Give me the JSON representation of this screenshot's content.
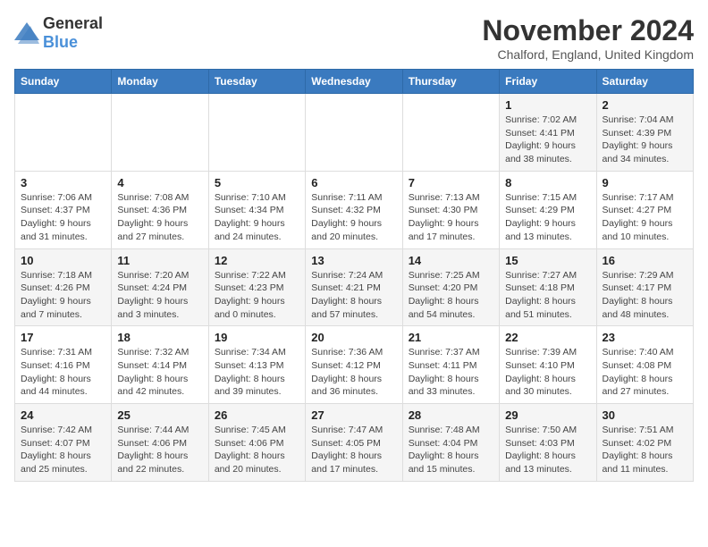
{
  "logo": {
    "general": "General",
    "blue": "Blue"
  },
  "title": "November 2024",
  "location": "Chalford, England, United Kingdom",
  "weekdays": [
    "Sunday",
    "Monday",
    "Tuesday",
    "Wednesday",
    "Thursday",
    "Friday",
    "Saturday"
  ],
  "weeks": [
    [
      {
        "day": "",
        "info": ""
      },
      {
        "day": "",
        "info": ""
      },
      {
        "day": "",
        "info": ""
      },
      {
        "day": "",
        "info": ""
      },
      {
        "day": "",
        "info": ""
      },
      {
        "day": "1",
        "info": "Sunrise: 7:02 AM\nSunset: 4:41 PM\nDaylight: 9 hours and 38 minutes."
      },
      {
        "day": "2",
        "info": "Sunrise: 7:04 AM\nSunset: 4:39 PM\nDaylight: 9 hours and 34 minutes."
      }
    ],
    [
      {
        "day": "3",
        "info": "Sunrise: 7:06 AM\nSunset: 4:37 PM\nDaylight: 9 hours and 31 minutes."
      },
      {
        "day": "4",
        "info": "Sunrise: 7:08 AM\nSunset: 4:36 PM\nDaylight: 9 hours and 27 minutes."
      },
      {
        "day": "5",
        "info": "Sunrise: 7:10 AM\nSunset: 4:34 PM\nDaylight: 9 hours and 24 minutes."
      },
      {
        "day": "6",
        "info": "Sunrise: 7:11 AM\nSunset: 4:32 PM\nDaylight: 9 hours and 20 minutes."
      },
      {
        "day": "7",
        "info": "Sunrise: 7:13 AM\nSunset: 4:30 PM\nDaylight: 9 hours and 17 minutes."
      },
      {
        "day": "8",
        "info": "Sunrise: 7:15 AM\nSunset: 4:29 PM\nDaylight: 9 hours and 13 minutes."
      },
      {
        "day": "9",
        "info": "Sunrise: 7:17 AM\nSunset: 4:27 PM\nDaylight: 9 hours and 10 minutes."
      }
    ],
    [
      {
        "day": "10",
        "info": "Sunrise: 7:18 AM\nSunset: 4:26 PM\nDaylight: 9 hours and 7 minutes."
      },
      {
        "day": "11",
        "info": "Sunrise: 7:20 AM\nSunset: 4:24 PM\nDaylight: 9 hours and 3 minutes."
      },
      {
        "day": "12",
        "info": "Sunrise: 7:22 AM\nSunset: 4:23 PM\nDaylight: 9 hours and 0 minutes."
      },
      {
        "day": "13",
        "info": "Sunrise: 7:24 AM\nSunset: 4:21 PM\nDaylight: 8 hours and 57 minutes."
      },
      {
        "day": "14",
        "info": "Sunrise: 7:25 AM\nSunset: 4:20 PM\nDaylight: 8 hours and 54 minutes."
      },
      {
        "day": "15",
        "info": "Sunrise: 7:27 AM\nSunset: 4:18 PM\nDaylight: 8 hours and 51 minutes."
      },
      {
        "day": "16",
        "info": "Sunrise: 7:29 AM\nSunset: 4:17 PM\nDaylight: 8 hours and 48 minutes."
      }
    ],
    [
      {
        "day": "17",
        "info": "Sunrise: 7:31 AM\nSunset: 4:16 PM\nDaylight: 8 hours and 44 minutes."
      },
      {
        "day": "18",
        "info": "Sunrise: 7:32 AM\nSunset: 4:14 PM\nDaylight: 8 hours and 42 minutes."
      },
      {
        "day": "19",
        "info": "Sunrise: 7:34 AM\nSunset: 4:13 PM\nDaylight: 8 hours and 39 minutes."
      },
      {
        "day": "20",
        "info": "Sunrise: 7:36 AM\nSunset: 4:12 PM\nDaylight: 8 hours and 36 minutes."
      },
      {
        "day": "21",
        "info": "Sunrise: 7:37 AM\nSunset: 4:11 PM\nDaylight: 8 hours and 33 minutes."
      },
      {
        "day": "22",
        "info": "Sunrise: 7:39 AM\nSunset: 4:10 PM\nDaylight: 8 hours and 30 minutes."
      },
      {
        "day": "23",
        "info": "Sunrise: 7:40 AM\nSunset: 4:08 PM\nDaylight: 8 hours and 27 minutes."
      }
    ],
    [
      {
        "day": "24",
        "info": "Sunrise: 7:42 AM\nSunset: 4:07 PM\nDaylight: 8 hours and 25 minutes."
      },
      {
        "day": "25",
        "info": "Sunrise: 7:44 AM\nSunset: 4:06 PM\nDaylight: 8 hours and 22 minutes."
      },
      {
        "day": "26",
        "info": "Sunrise: 7:45 AM\nSunset: 4:06 PM\nDaylight: 8 hours and 20 minutes."
      },
      {
        "day": "27",
        "info": "Sunrise: 7:47 AM\nSunset: 4:05 PM\nDaylight: 8 hours and 17 minutes."
      },
      {
        "day": "28",
        "info": "Sunrise: 7:48 AM\nSunset: 4:04 PM\nDaylight: 8 hours and 15 minutes."
      },
      {
        "day": "29",
        "info": "Sunrise: 7:50 AM\nSunset: 4:03 PM\nDaylight: 8 hours and 13 minutes."
      },
      {
        "day": "30",
        "info": "Sunrise: 7:51 AM\nSunset: 4:02 PM\nDaylight: 8 hours and 11 minutes."
      }
    ]
  ]
}
